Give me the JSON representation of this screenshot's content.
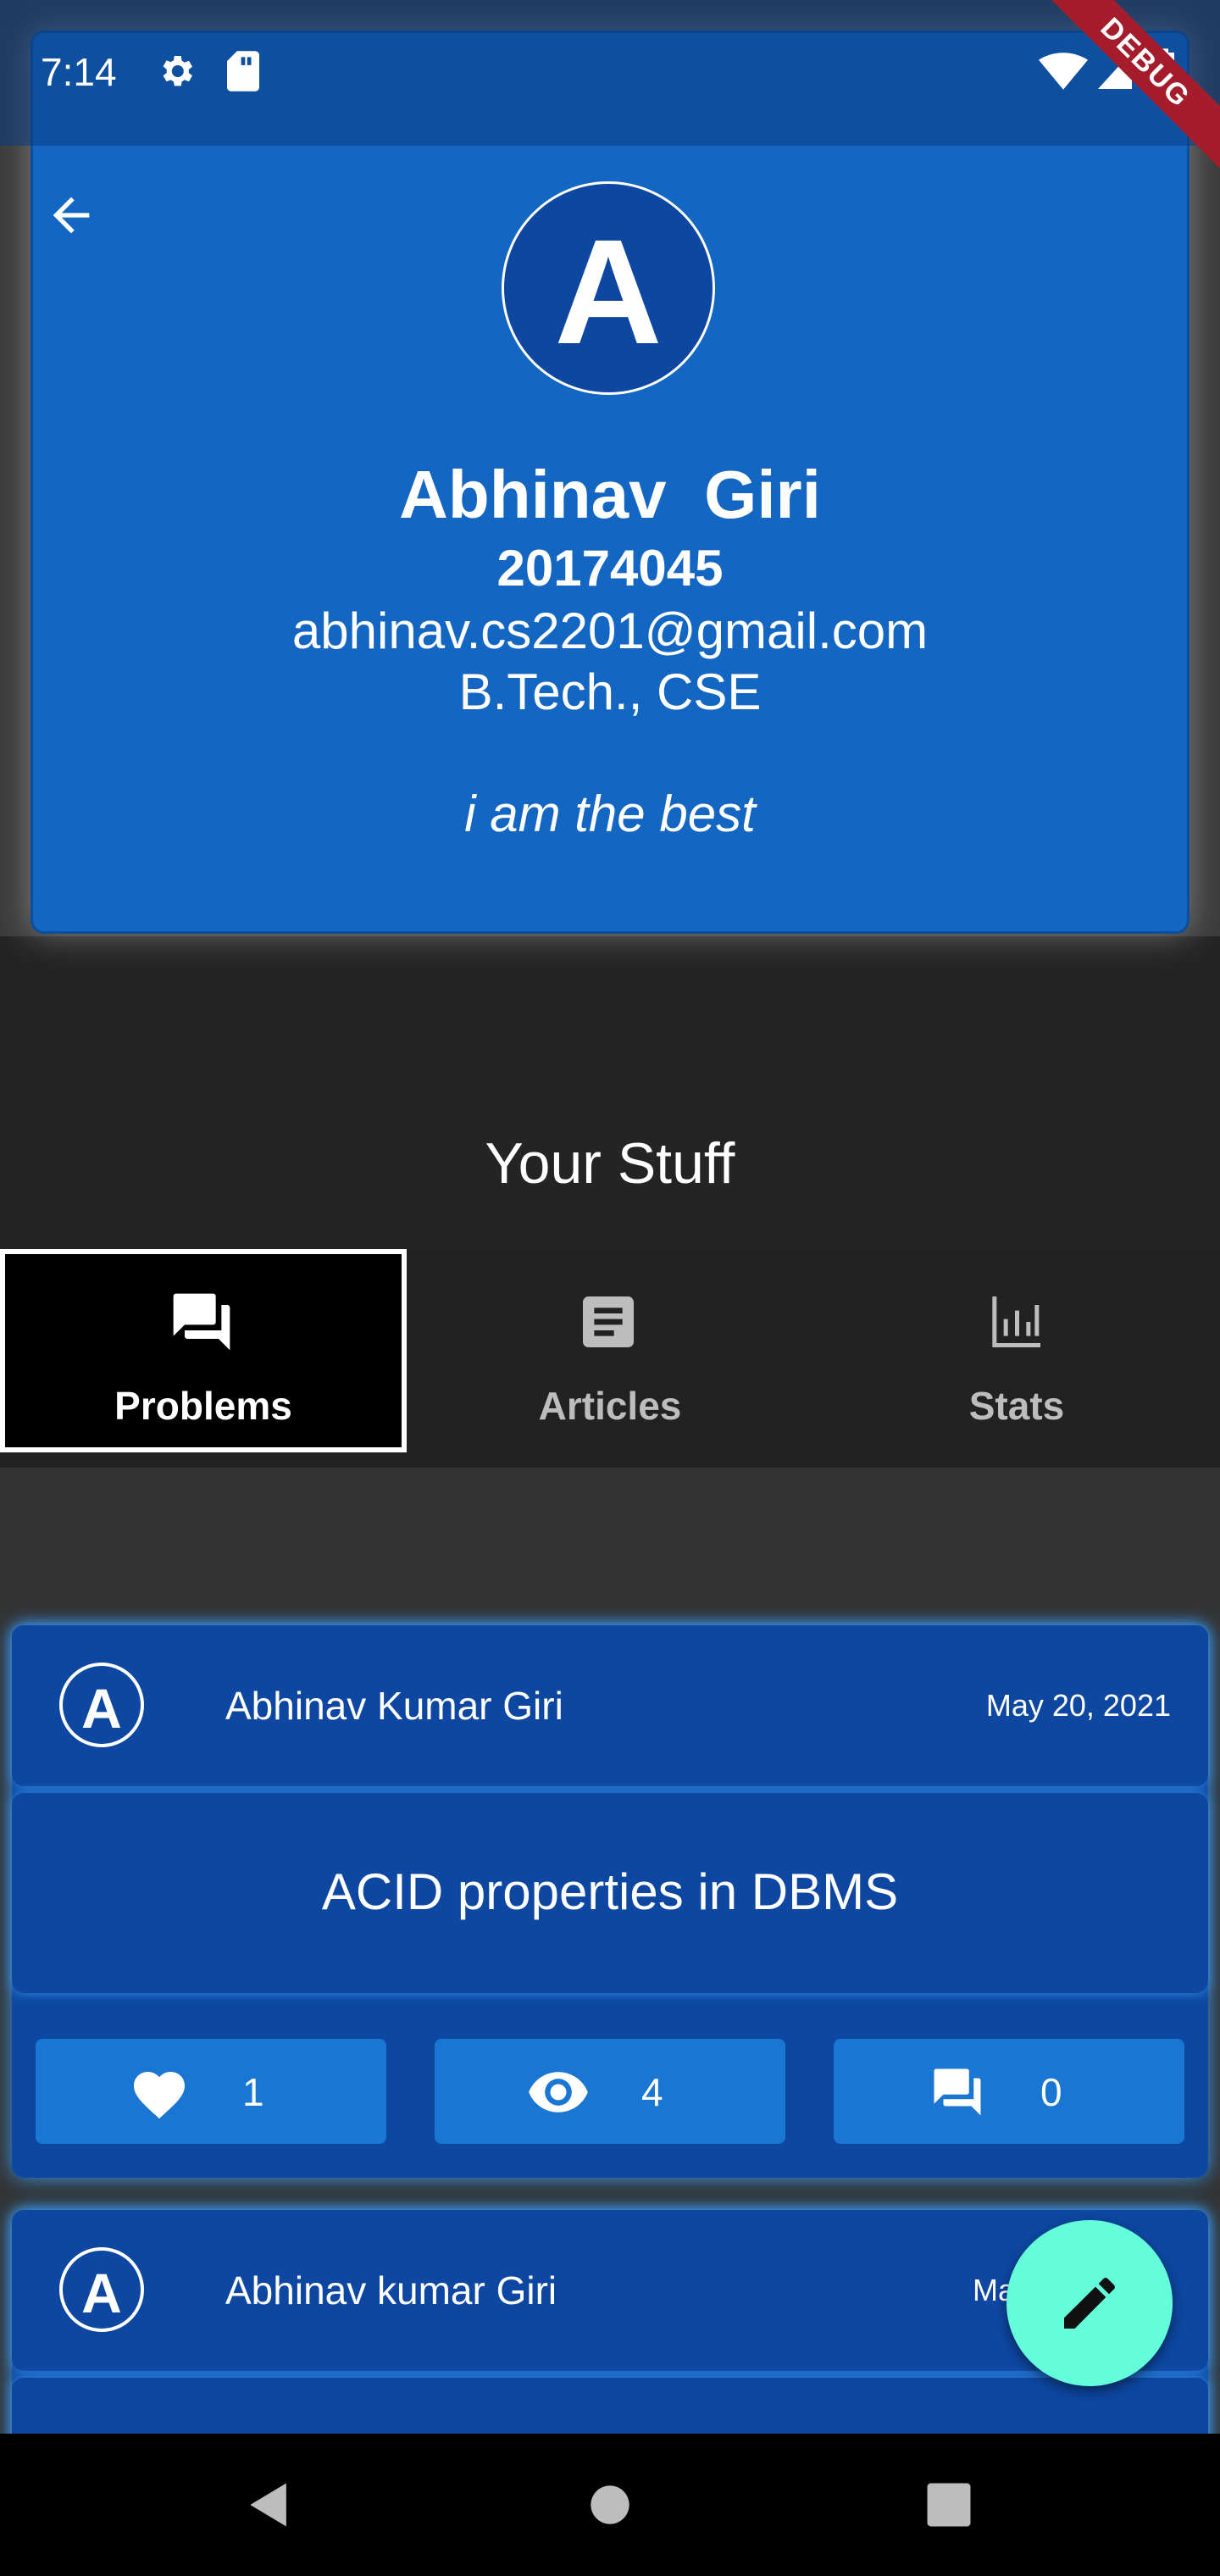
{
  "status_bar": {
    "time": "7:14",
    "icons": [
      "gear-icon",
      "sd-card-icon",
      "wifi-icon",
      "signal-icon",
      "battery-icon"
    ]
  },
  "debug_banner": "DEBUG",
  "profile": {
    "avatar_letter": "A",
    "name": "Abhinav  Giri",
    "roll": "20174045",
    "email": "abhinav.cs2201@gmail.com",
    "course": "B.Tech., CSE",
    "bio": "i am the best"
  },
  "section_title": "Your Stuff",
  "tabs": [
    {
      "label": "Problems",
      "icon": "forum-icon",
      "active": true
    },
    {
      "label": "Articles",
      "icon": "article-icon",
      "active": false
    },
    {
      "label": "Stats",
      "icon": "bar-chart-icon",
      "active": false
    }
  ],
  "posts": [
    {
      "avatar_letter": "A",
      "author": "Abhinav Kumar Giri",
      "date": "May 20, 2021",
      "title": "ACID properties in DBMS",
      "likes": "1",
      "views": "4",
      "comments": "0"
    },
    {
      "avatar_letter": "A",
      "author": "Abhinav kumar Giri",
      "date": "Ma"
    }
  ],
  "colors": {
    "card_blue": "#1466c3",
    "post_blue": "#0d47a1",
    "button_blue": "#1976d2",
    "fab": "#64ffda",
    "background": "#242424"
  }
}
